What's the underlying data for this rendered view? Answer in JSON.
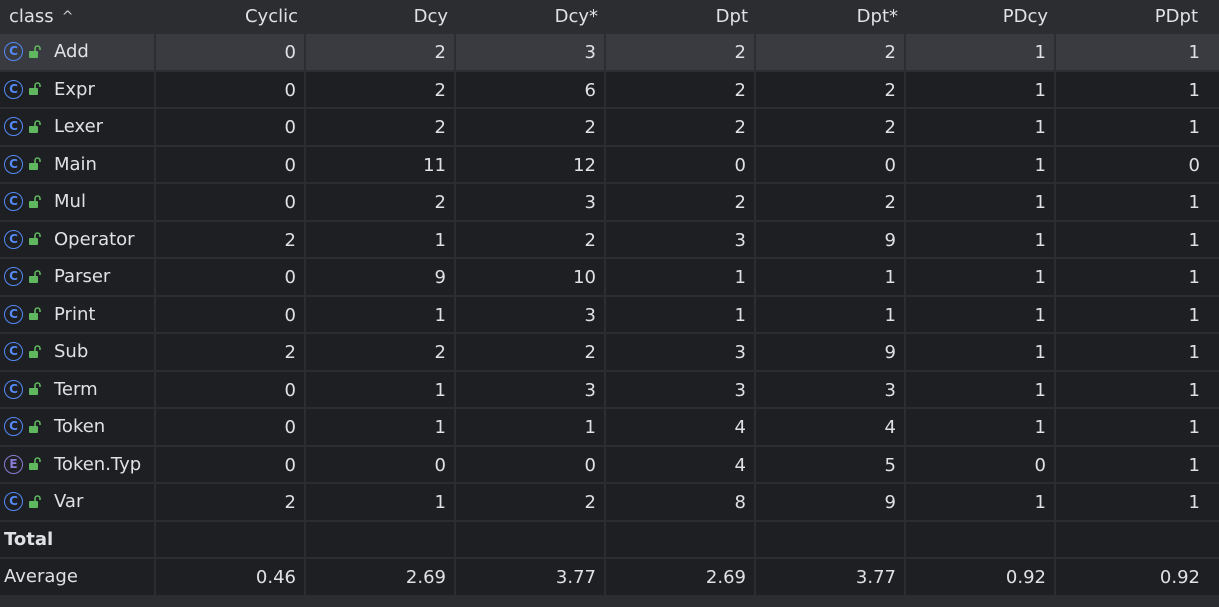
{
  "header": {
    "columns": [
      "class",
      "Cyclic",
      "Dcy",
      "Dcy*",
      "Dpt",
      "Dpt*",
      "PDcy",
      "PDpt"
    ],
    "sort_indicator": "^"
  },
  "rows": [
    {
      "kind": "C",
      "name": "Add",
      "cyclic": "0",
      "dcy": "2",
      "dcy_star": "3",
      "dpt": "2",
      "dpt_star": "2",
      "pdcy": "1",
      "pdpt": "1"
    },
    {
      "kind": "C",
      "name": "Expr",
      "cyclic": "0",
      "dcy": "2",
      "dcy_star": "6",
      "dpt": "2",
      "dpt_star": "2",
      "pdcy": "1",
      "pdpt": "1"
    },
    {
      "kind": "C",
      "name": "Lexer",
      "cyclic": "0",
      "dcy": "2",
      "dcy_star": "2",
      "dpt": "2",
      "dpt_star": "2",
      "pdcy": "1",
      "pdpt": "1"
    },
    {
      "kind": "C",
      "name": "Main",
      "cyclic": "0",
      "dcy": "11",
      "dcy_star": "12",
      "dpt": "0",
      "dpt_star": "0",
      "pdcy": "1",
      "pdpt": "0"
    },
    {
      "kind": "C",
      "name": "Mul",
      "cyclic": "0",
      "dcy": "2",
      "dcy_star": "3",
      "dpt": "2",
      "dpt_star": "2",
      "pdcy": "1",
      "pdpt": "1"
    },
    {
      "kind": "C",
      "name": "Operator",
      "cyclic": "2",
      "dcy": "1",
      "dcy_star": "2",
      "dpt": "3",
      "dpt_star": "9",
      "pdcy": "1",
      "pdpt": "1"
    },
    {
      "kind": "C",
      "name": "Parser",
      "cyclic": "0",
      "dcy": "9",
      "dcy_star": "10",
      "dpt": "1",
      "dpt_star": "1",
      "pdcy": "1",
      "pdpt": "1"
    },
    {
      "kind": "C",
      "name": "Print",
      "cyclic": "0",
      "dcy": "1",
      "dcy_star": "3",
      "dpt": "1",
      "dpt_star": "1",
      "pdcy": "1",
      "pdpt": "1"
    },
    {
      "kind": "C",
      "name": "Sub",
      "cyclic": "2",
      "dcy": "2",
      "dcy_star": "2",
      "dpt": "3",
      "dpt_star": "9",
      "pdcy": "1",
      "pdpt": "1"
    },
    {
      "kind": "C",
      "name": "Term",
      "cyclic": "0",
      "dcy": "1",
      "dcy_star": "3",
      "dpt": "3",
      "dpt_star": "3",
      "pdcy": "1",
      "pdpt": "1"
    },
    {
      "kind": "C",
      "name": "Token",
      "cyclic": "0",
      "dcy": "1",
      "dcy_star": "1",
      "dpt": "4",
      "dpt_star": "4",
      "pdcy": "1",
      "pdpt": "1"
    },
    {
      "kind": "E",
      "name": "Token.Typ",
      "cyclic": "0",
      "dcy": "0",
      "dcy_star": "0",
      "dpt": "4",
      "dpt_star": "5",
      "pdcy": "0",
      "pdpt": "1"
    },
    {
      "kind": "C",
      "name": "Var",
      "cyclic": "2",
      "dcy": "1",
      "dcy_star": "2",
      "dpt": "8",
      "dpt_star": "9",
      "pdcy": "1",
      "pdpt": "1"
    }
  ],
  "total": {
    "label": "Total"
  },
  "average": {
    "label": "Average",
    "cyclic": "0.46",
    "dcy": "2.69",
    "dcy_star": "3.77",
    "dpt": "2.69",
    "dpt_star": "3.77",
    "pdcy": "0.92",
    "pdpt": "0.92"
  },
  "selected_row": 0,
  "colors": {
    "class_icon": "#548af7",
    "enum_icon": "#8a7bd6",
    "lock_icon": "#5fb85f",
    "selected_bg": "#393b40"
  }
}
